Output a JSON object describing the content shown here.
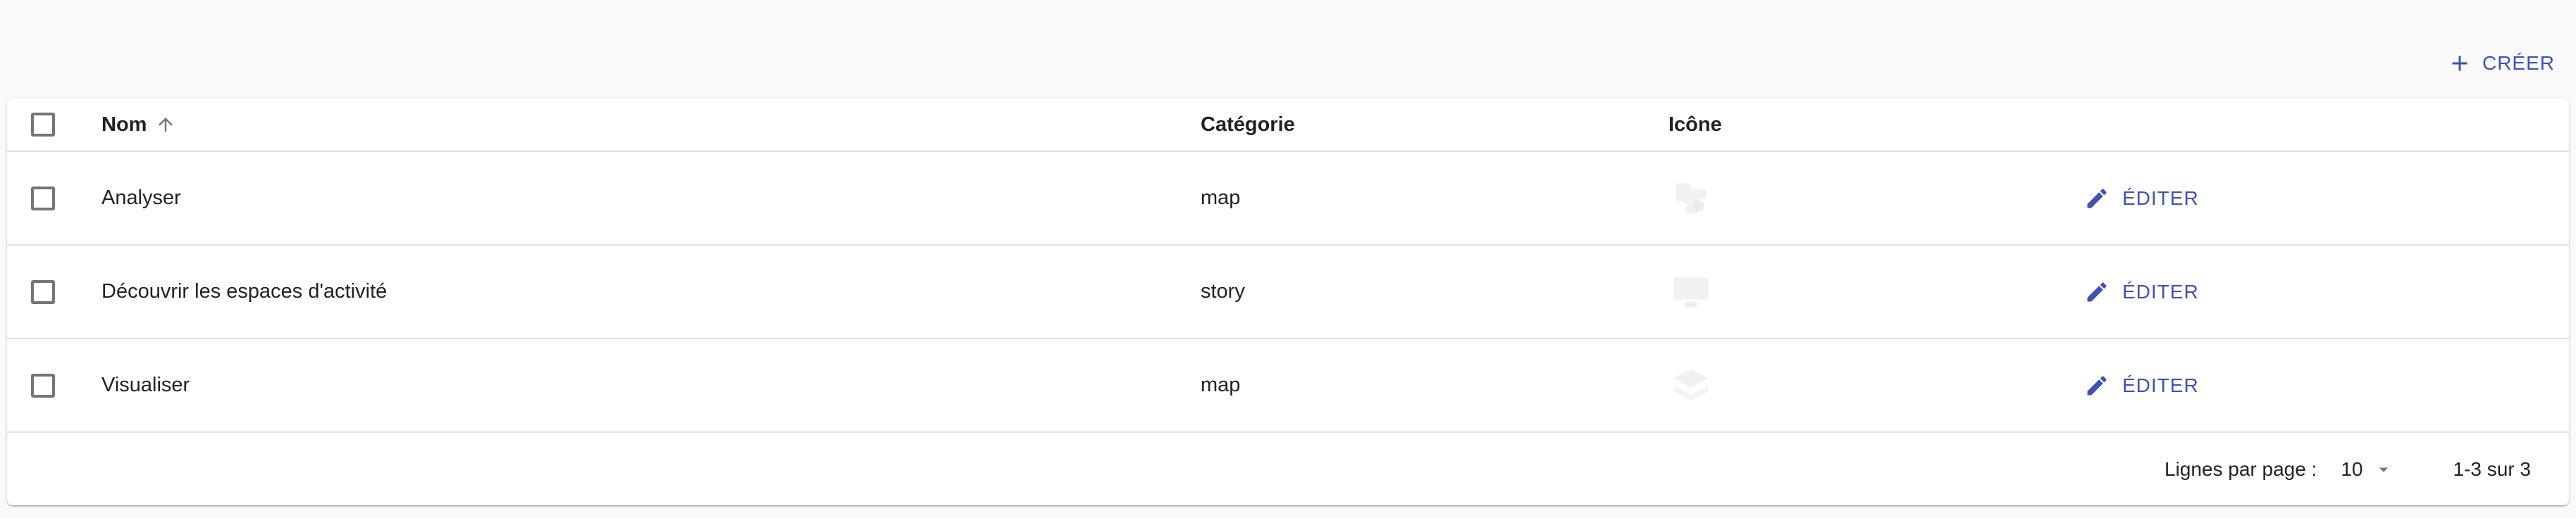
{
  "toolbar": {
    "create_label": "CRÉER",
    "create_icon": "plus-icon",
    "accent_color": "#3f51b5"
  },
  "table": {
    "columns": {
      "name": "Nom",
      "category": "Catégorie",
      "icon": "Icône"
    },
    "sort": {
      "column": "Nom",
      "direction": "asc",
      "icon": "arrow-up-icon"
    },
    "rows": [
      {
        "name": "Analyser",
        "category": "map",
        "icon": "map-analysis-icon",
        "edit_label": "ÉDITER",
        "selected": false
      },
      {
        "name": "Découvrir les espaces d'activité",
        "category": "story",
        "icon": "monitor-icon",
        "edit_label": "ÉDITER",
        "selected": false
      },
      {
        "name": "Visualiser",
        "category": "map",
        "icon": "layers-icon",
        "edit_label": "ÉDITER",
        "selected": false
      }
    ]
  },
  "pagination": {
    "rows_per_page_label": "Lignes par page :",
    "rows_per_page_value": "10",
    "range_label": "1-3 sur 3"
  }
}
